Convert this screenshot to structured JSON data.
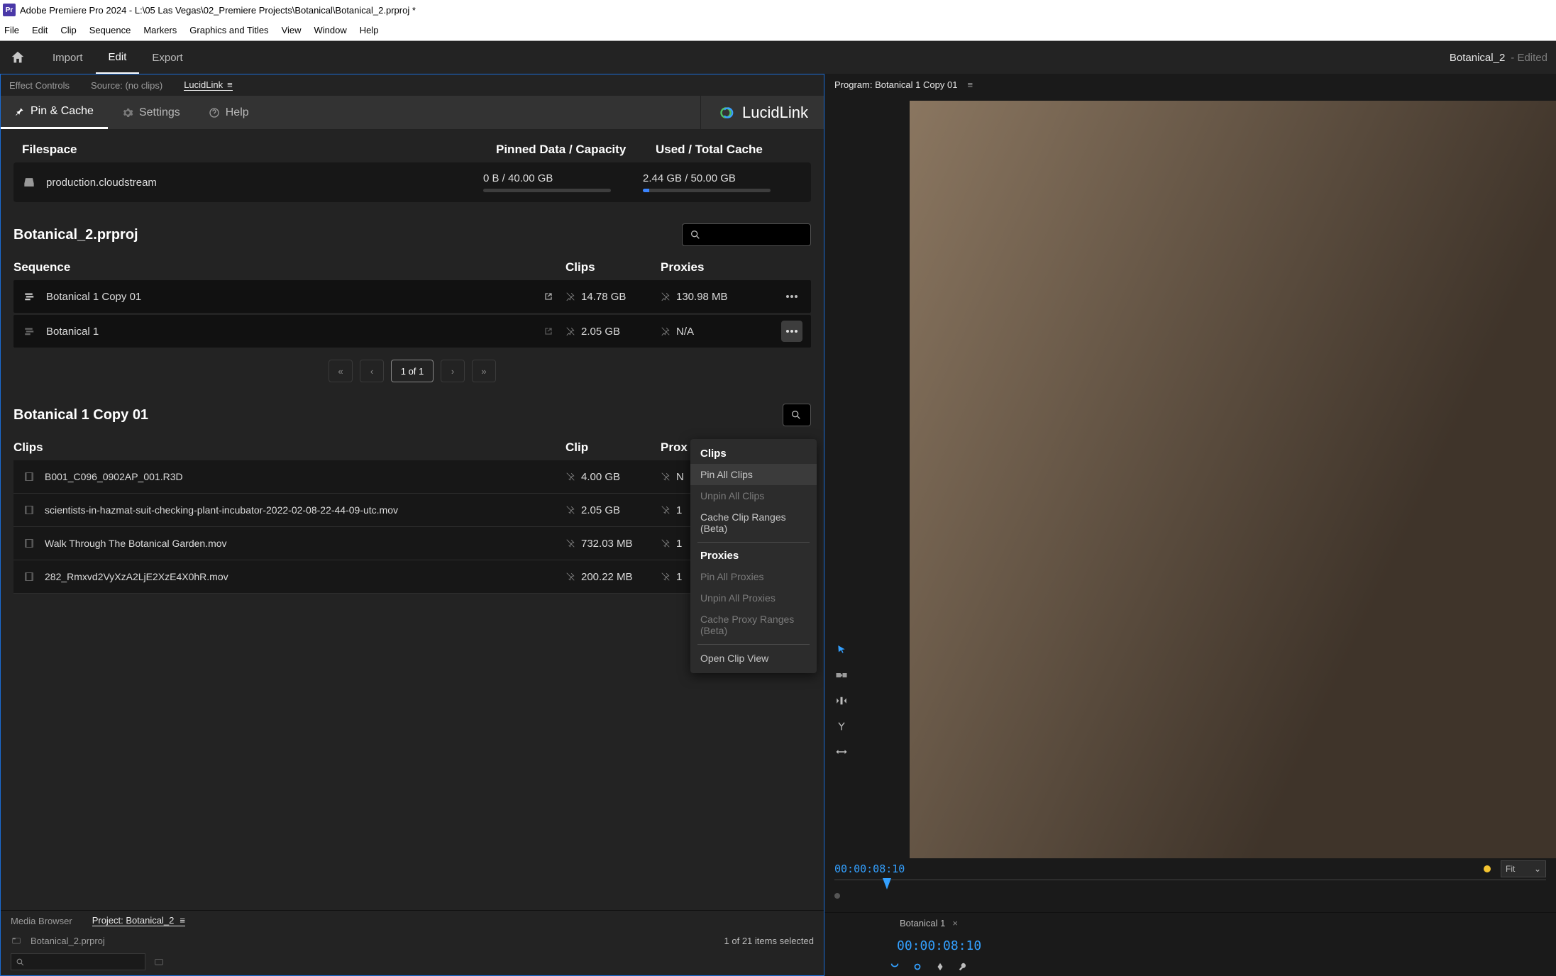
{
  "window": {
    "title": "Adobe Premiere Pro 2024 - L:\\05 Las Vegas\\02_Premiere Projects\\Botanical\\Botanical_2.prproj *",
    "menu": [
      "File",
      "Edit",
      "Clip",
      "Sequence",
      "Markers",
      "Graphics and Titles",
      "View",
      "Window",
      "Help"
    ]
  },
  "topnav": {
    "tabs": [
      "Import",
      "Edit",
      "Export"
    ],
    "active": "Edit",
    "project": "Botanical_2",
    "status": "- Edited"
  },
  "subtabs": {
    "items": [
      "Effect Controls",
      "Source: (no clips)",
      "LucidLink"
    ],
    "active": "LucidLink"
  },
  "lucidlink": {
    "tabs": {
      "pin_cache": "Pin & Cache",
      "settings": "Settings",
      "help": "Help"
    },
    "brand": "LucidLink",
    "stats": {
      "filespace_label": "Filespace",
      "pinned_label": "Pinned Data / Capacity",
      "cache_label": "Used / Total Cache",
      "filespace_name": "production.cloudstream",
      "pinned_value": "0 B / 40.00 GB",
      "cache_value": "2.44 GB / 50.00 GB",
      "cache_fill_percent": 5
    },
    "project_title": "Botanical_2.prproj",
    "seq_headers": {
      "sequence": "Sequence",
      "clips": "Clips",
      "proxies": "Proxies"
    },
    "sequences": [
      {
        "name": "Botanical 1 Copy 01",
        "clips_size": "14.78 GB",
        "proxies_size": "130.98 MB"
      },
      {
        "name": "Botanical 1",
        "clips_size": "2.05 GB",
        "proxies_size": "N/A"
      }
    ],
    "pager": {
      "text": "1 of 1"
    },
    "seq_detail_title": "Botanical 1 Copy 01",
    "clip_headers": {
      "clips": "Clips",
      "clip": "Clip",
      "proxy": "Prox"
    },
    "clips": [
      {
        "name": "B001_C096_0902AP_001.R3D",
        "size": "4.00 GB",
        "proxy": "N"
      },
      {
        "name": "scientists-in-hazmat-suit-checking-plant-incubator-2022-02-08-22-44-09-utc.mov",
        "size": "2.05 GB",
        "proxy": "1"
      },
      {
        "name": "Walk Through The Botanical Garden.mov",
        "size": "732.03 MB",
        "proxy": "1"
      },
      {
        "name": "282_Rmxvd2VyXzA2LjE2XzE4X0hR.mov",
        "size": "200.22 MB",
        "proxy": "1"
      }
    ],
    "context_menu": {
      "clips_header": "Clips",
      "pin_all_clips": "Pin All Clips",
      "unpin_all_clips": "Unpin All Clips",
      "cache_clip_ranges": "Cache Clip Ranges (Beta)",
      "proxies_header": "Proxies",
      "pin_all_proxies": "Pin All Proxies",
      "unpin_all_proxies": "Unpin All Proxies",
      "cache_proxy_ranges": "Cache Proxy Ranges (Beta)",
      "open_clip_view": "Open Clip View"
    }
  },
  "bottom_panel": {
    "tabs": {
      "media_browser": "Media Browser",
      "project": "Project: Botanical_2"
    },
    "breadcrumb": "Botanical_2.prproj",
    "selection": "1 of 21 items selected"
  },
  "program_monitor": {
    "title": "Program: Botanical 1 Copy 01",
    "timecode": "00:00:08:10",
    "fit": "Fit",
    "sequence_tab": "Botanical 1",
    "timeline_tc": "00:00:08:10"
  }
}
